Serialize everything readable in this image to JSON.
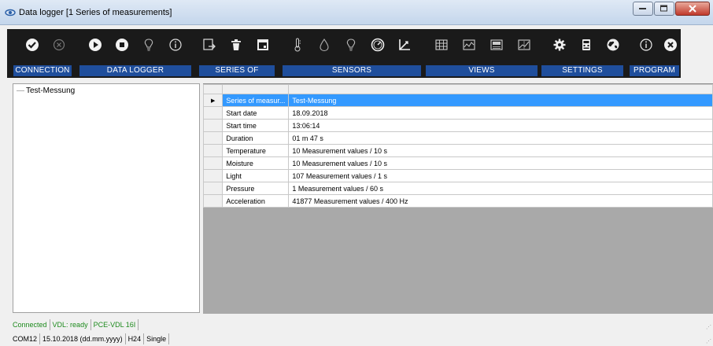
{
  "window": {
    "title": "Data logger [1 Series of measurements]"
  },
  "toolbar": {
    "groups": [
      {
        "label": "CONNECTION"
      },
      {
        "label": "DATA LOGGER"
      },
      {
        "label": "SERIES OF"
      },
      {
        "label": "SENSORS"
      },
      {
        "label": "VIEWS"
      },
      {
        "label": "SETTINGS"
      },
      {
        "label": "PROGRAM"
      }
    ],
    "icons": [
      "connect-check-icon",
      "disconnect-x-icon",
      "play-icon",
      "stop-icon",
      "bulb-icon",
      "info-icon",
      "export-icon",
      "trash-icon",
      "calendar-icon",
      "thermometer-icon",
      "drop-icon",
      "bulb-icon",
      "gauge-icon",
      "axis-icon",
      "table-view-icon",
      "chart-view-icon",
      "device-view-icon",
      "graph-view-icon",
      "gear-icon",
      "calculator-icon",
      "globe-icon",
      "info-icon",
      "close-icon"
    ]
  },
  "tree": {
    "items": [
      {
        "label": "Test-Messung"
      }
    ]
  },
  "grid": {
    "rows": [
      {
        "field": "Series of measur...",
        "value": "Test-Messung"
      },
      {
        "field": "Start date",
        "value": "18.09.2018"
      },
      {
        "field": "Start time",
        "value": "13:06:14"
      },
      {
        "field": "Duration",
        "value": "01 m 47 s"
      },
      {
        "field": "Temperature",
        "value": "10 Measurement values / 10 s"
      },
      {
        "field": "Moisture",
        "value": "10 Measurement values / 10 s"
      },
      {
        "field": "Light",
        "value": "107 Measurement values / 1 s"
      },
      {
        "field": "Pressure",
        "value": "1 Measurement values / 60 s"
      },
      {
        "field": "Acceleration",
        "value": "41877 Measurement values / 400 Hz"
      }
    ],
    "selected_row_marker": "▶"
  },
  "status": {
    "line1": [
      "Connected",
      "VDL: ready",
      "PCE-VDL 16I"
    ],
    "line2": [
      "COM12",
      "15.10.2018 (dd.mm.yyyy)",
      "H24",
      "Single"
    ]
  },
  "colors": {
    "toolbar_bg": "#1a1a1a",
    "group_label_bg": "#1f4e9c",
    "selection": "#3399ff",
    "status_green": "#1d8a1d"
  }
}
